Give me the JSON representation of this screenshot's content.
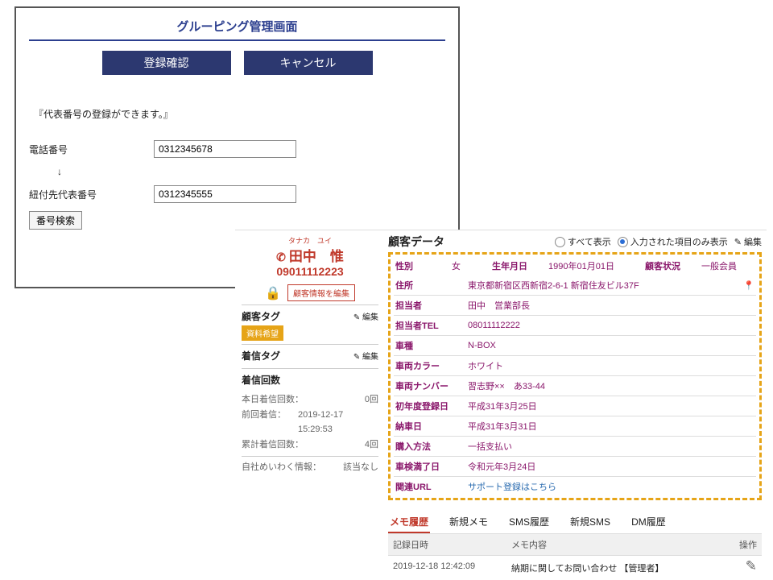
{
  "panelA": {
    "title": "グルーピング管理画面",
    "confirm": "登録確認",
    "cancel": "キャンセル",
    "note": "『代表番号の登録ができます。』",
    "phone_label": "電話番号",
    "phone_value": "0312345678",
    "arrow": "↓",
    "rep_label": "紐付先代表番号",
    "rep_value": "0312345555",
    "search_btn": "番号検索"
  },
  "card": {
    "furigana": "タナカ　ユイ",
    "name": "田中　惟",
    "tel": "09011112223",
    "edit_info": "顧客情報を編集",
    "sect_cust_tag": "顧客タグ",
    "edit_label": "編集",
    "tag_value": "資料希望",
    "sect_in_tag": "着信タグ",
    "sect_count": "着信回数",
    "counts": {
      "today_k": "本日着信回数：",
      "today_v": "0回",
      "prev_k": "前回着信：",
      "prev_v": "2019-12-17 15:29:53",
      "total_k": "累計着信回数：",
      "total_v": "4回"
    },
    "spam_k": "自社めいわく情報：",
    "spam_v": "該当なし"
  },
  "sheet": {
    "title": "顧客データ",
    "opt_all": "すべて表示",
    "opt_filled": "入力された項目のみ表示",
    "edit_label": "編集",
    "rows1": {
      "sex_k": "性別",
      "sex_v": "女",
      "dob_k": "生年月日",
      "dob_v": "1990年01月01日",
      "status_k": "顧客状況",
      "status_v": "一般会員"
    },
    "rows": [
      {
        "k": "住所",
        "v": "東京都新宿区西新宿2-6-1 新宿住友ビル37F",
        "pin": true
      },
      {
        "k": "担当者",
        "v": "田中　営業部長"
      },
      {
        "k": "担当者TEL",
        "v": "08011112222"
      },
      {
        "k": "車種",
        "v": "N-BOX"
      },
      {
        "k": "車両カラー",
        "v": "ホワイト"
      },
      {
        "k": "車両ナンバー",
        "v": "習志野××　あ33-44"
      },
      {
        "k": "初年度登録日",
        "v": "平成31年3月25日"
      },
      {
        "k": "納車日",
        "v": "平成31年3月31日"
      },
      {
        "k": "購入方法",
        "v": "一括支払い"
      },
      {
        "k": "車検満了日",
        "v": "令和元年3月24日"
      },
      {
        "k": "関連URL",
        "v": "サポート登録はこちら",
        "link": true
      }
    ],
    "tabs": [
      "メモ履歴",
      "新規メモ",
      "SMS履歴",
      "新規SMS",
      "DM履歴"
    ],
    "memo_head": {
      "c1": "記録日時",
      "c2": "メモ内容",
      "c3": "操作"
    },
    "memo_rows": [
      {
        "ts": "2019-12-18 12:42:09",
        "body": "納期に関してお問い合わせ 【管理者】"
      }
    ]
  }
}
